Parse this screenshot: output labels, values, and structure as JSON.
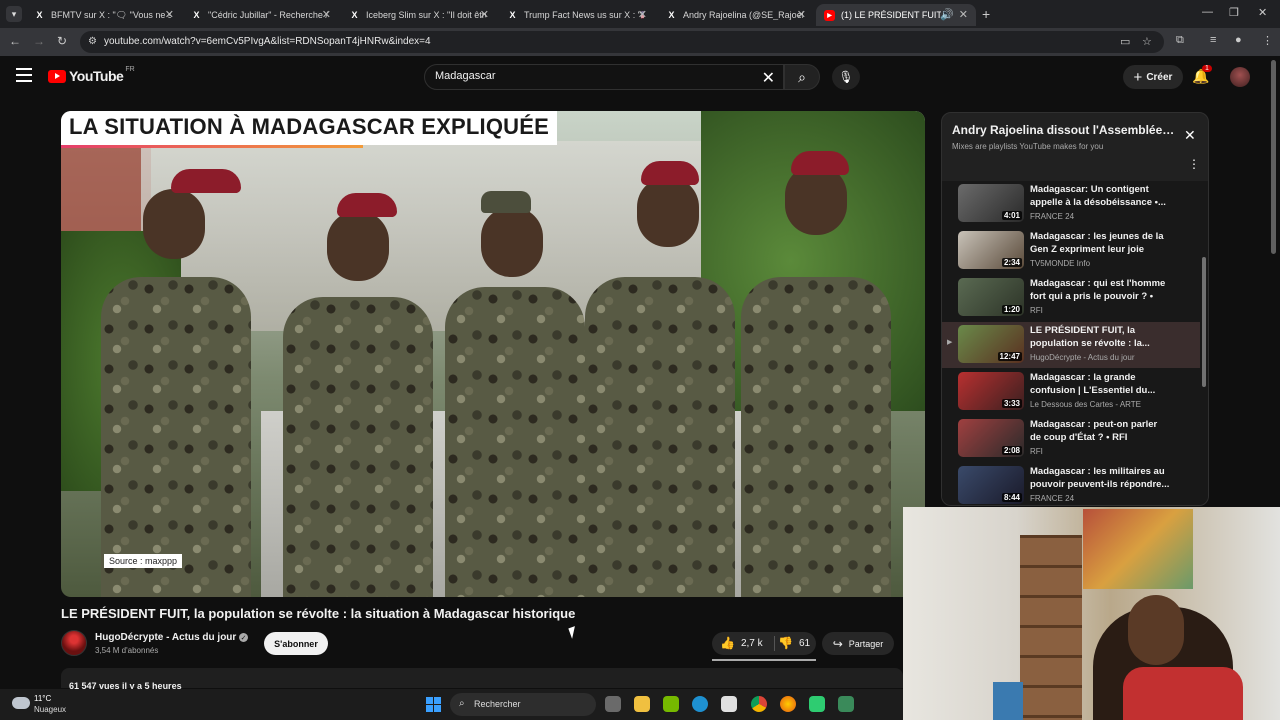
{
  "browser": {
    "tabs": [
      {
        "title": "BFMTV sur X : \"🗨 \"Vous ne se",
        "favicon": "X"
      },
      {
        "title": "\"Cédric Jubillar\" - Recherche / X",
        "favicon": "X"
      },
      {
        "title": "Iceberg Slim sur X : \"Il doit être",
        "favicon": "X"
      },
      {
        "title": "Trump Fact News us sur X : \"🇺🇸",
        "favicon": "X"
      },
      {
        "title": "Andry Rajoelina (@SE_Rajoelina",
        "favicon": "X"
      },
      {
        "title": "(1) LE PRÉSIDENT FUIT, la p",
        "favicon": "youtube"
      }
    ],
    "url": "youtube.com/watch?v=6emCv5PIvgA&list=RDNSopanT4jHNRw&index=4"
  },
  "header": {
    "logo_text": "YouTube",
    "country": "FR",
    "search_value": "Madagascar",
    "create_label": "Créer",
    "notification_count": "1"
  },
  "video": {
    "overlay_title": "LA SITUATION À MADAGASCAR EXPLIQUÉE",
    "source_caption": "Source : maxppp",
    "title": "LE PRÉSIDENT FUIT, la population se révolte : la situation à Madagascar historique",
    "channel": "HugoDécrypte - Actus du jour",
    "subscribers": "3,54 M d'abonnés",
    "subscribe_label": "S'abonner",
    "likes": "2,7 k",
    "dislikes": "61",
    "share_label": "Partager",
    "views_line": "61 547 vues  il y a 5 heures"
  },
  "playlist": {
    "title": "Andry Rajoelina dissout l'Assemblée nationale",
    "subtitle": "Mixes are playlists YouTube makes for you",
    "items": [
      {
        "title": "Madagascar: Un contigent appelle à la désobéissance •...",
        "channel": "FRANCE 24",
        "duration": "4:01",
        "active": false
      },
      {
        "title": "Madagascar : les jeunes de la Gen Z expriment leur joie",
        "channel": "TV5MONDE Info",
        "duration": "2:34",
        "active": false
      },
      {
        "title": "Madagascar : qui est l'homme fort qui a pris le pouvoir ? • RFI",
        "channel": "RFI",
        "duration": "1:20",
        "active": false
      },
      {
        "title": "LE PRÉSIDENT FUIT, la population se révolte : la...",
        "channel": "HugoDécrypte - Actus du jour",
        "duration": "12:47",
        "active": true
      },
      {
        "title": "Madagascar : la grande confusion | L'Essentiel du...",
        "channel": "Le Dessous des Cartes - ARTE",
        "duration": "3:33",
        "active": false
      },
      {
        "title": "Madagascar : peut-on parler de coup d'État ? • RFI",
        "channel": "RFI",
        "duration": "2:08",
        "active": false
      },
      {
        "title": "Madagascar : les militaires au pouvoir peuvent-ils répondre...",
        "channel": "FRANCE 24",
        "duration": "8:44",
        "active": false
      }
    ]
  },
  "taskbar": {
    "temperature": "11°C",
    "weather": "Nuageux",
    "search_label": "Rechercher"
  },
  "colors": {
    "brand_red": "#ff0000",
    "background": "#0f0f0f",
    "accent_gradient_start": "#e53e6a",
    "accent_gradient_end": "#f29b3a"
  }
}
